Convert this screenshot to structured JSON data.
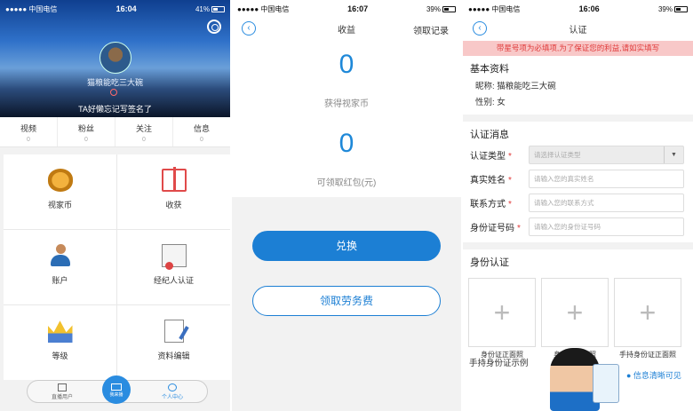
{
  "status": {
    "carrier": "●●●●● 中国电信",
    "p1_time": "16:04",
    "p1_batt": "41%",
    "p2_time": "16:07",
    "p2_batt": "39%",
    "p3_time": "16:06",
    "p3_batt": "39%"
  },
  "profile": {
    "nickname": "猫粮能吃三大碗",
    "signature": "TA好懒忘记写签名了",
    "stats": [
      {
        "label": "视频",
        "count": "0"
      },
      {
        "label": "粉丝",
        "count": "0"
      },
      {
        "label": "关注",
        "count": "0"
      },
      {
        "label": "信息",
        "count": "0"
      }
    ],
    "menu": [
      {
        "label": "视家币",
        "icon": "coins-icon"
      },
      {
        "label": "收获",
        "icon": "gift-icon"
      },
      {
        "label": "账户",
        "icon": "account-icon"
      },
      {
        "label": "经纪人认证",
        "icon": "certificate-icon"
      },
      {
        "label": "等级",
        "icon": "crown-icon"
      },
      {
        "label": "资料编辑",
        "icon": "edit-document-icon"
      }
    ],
    "tabs": {
      "home": "直播用户",
      "center": "我来播",
      "me": "个人中心"
    }
  },
  "earnings": {
    "title": "收益",
    "record": "领取记录",
    "coins_value": "0",
    "coins_label": "获得视家币",
    "redpacket_value": "0",
    "redpacket_label": "可领取红包(元)",
    "exchange": "兑换",
    "labor_fee": "领取劳务费"
  },
  "auth": {
    "title": "认证",
    "warning": "带星号项为必填项,为了保证您的利益,请如实填写",
    "basic_title": "基本资料",
    "nickname_line": "昵称: 猫粮能吃三大碗",
    "gender_line": "性别: 女",
    "auth_title": "认证消息",
    "fields": [
      {
        "label": "认证类型",
        "placeholder": "请选择认证类型"
      },
      {
        "label": "真实姓名",
        "placeholder": "请输入您的真实姓名"
      },
      {
        "label": "联系方式",
        "placeholder": "请输入您的联系方式"
      },
      {
        "label": "身份证号码",
        "placeholder": "请输入您的身份证号码"
      }
    ],
    "id_title": "身份认证",
    "id_photos": [
      "身份证正面照",
      "身份证反面照",
      "手持身份证正面照"
    ],
    "example": "手持身份证示例",
    "clear_hint": "● 信息清晰可见"
  },
  "colors": {
    "accent": "#1c7fd4",
    "warning_bg": "#f8c8c8",
    "required": "#e03a3a"
  }
}
